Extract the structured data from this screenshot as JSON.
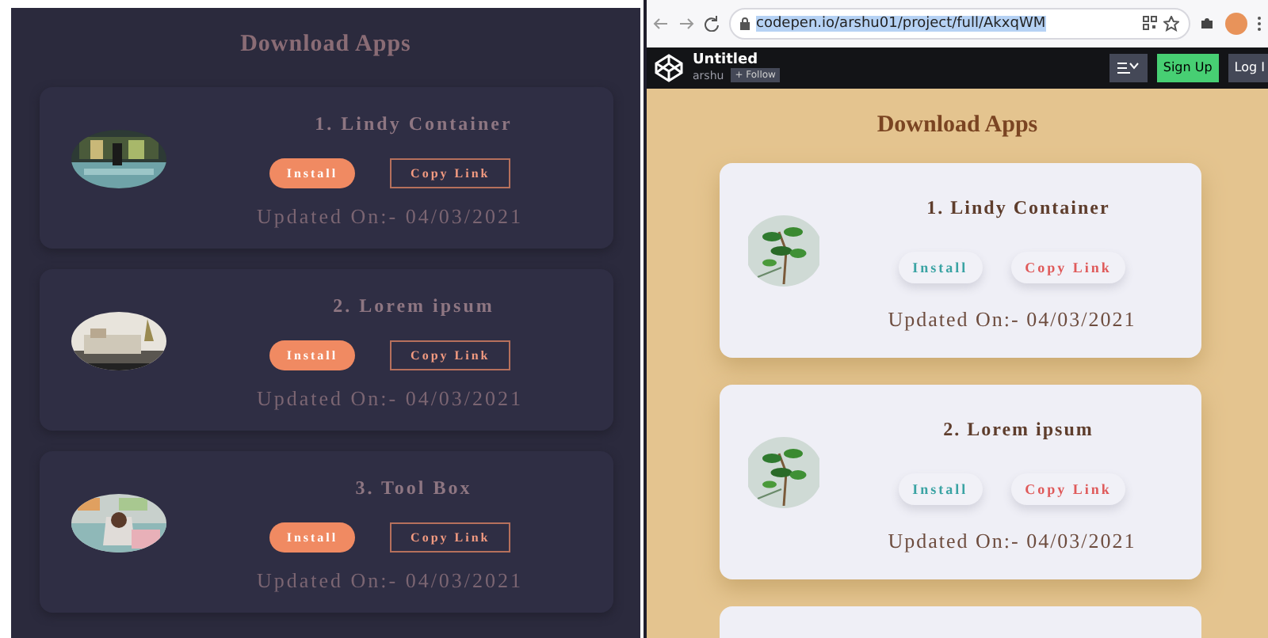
{
  "dark_page": {
    "heading": "Download Apps",
    "apps": [
      {
        "title": "1. Lindy Container",
        "install": "Install",
        "copy_link": "Copy Link",
        "updated": "Updated On:- 04/03/2021"
      },
      {
        "title": "2. Lorem ipsum",
        "install": "Install",
        "copy_link": "Copy Link",
        "updated": "Updated On:- 04/03/2021"
      },
      {
        "title": "3. Tool Box",
        "install": "Install",
        "copy_link": "Copy Link",
        "updated": "Updated On:- 04/03/2021"
      }
    ]
  },
  "browser": {
    "url": "codepen.io/arshu01/project/full/AkxqWM",
    "pen_title": "Untitled",
    "author": "arshu",
    "follow": "+ Follow",
    "sign_up": "Sign Up",
    "log_in": "Log I"
  },
  "light_page": {
    "heading": "Download Apps",
    "apps": [
      {
        "title": "1. Lindy Container",
        "install": "Install",
        "copy_link": "Copy Link",
        "updated": "Updated On:- 04/03/2021"
      },
      {
        "title": "2. Lorem ipsum",
        "install": "Install",
        "copy_link": "Copy Link",
        "updated": "Updated On:- 04/03/2021"
      }
    ]
  }
}
